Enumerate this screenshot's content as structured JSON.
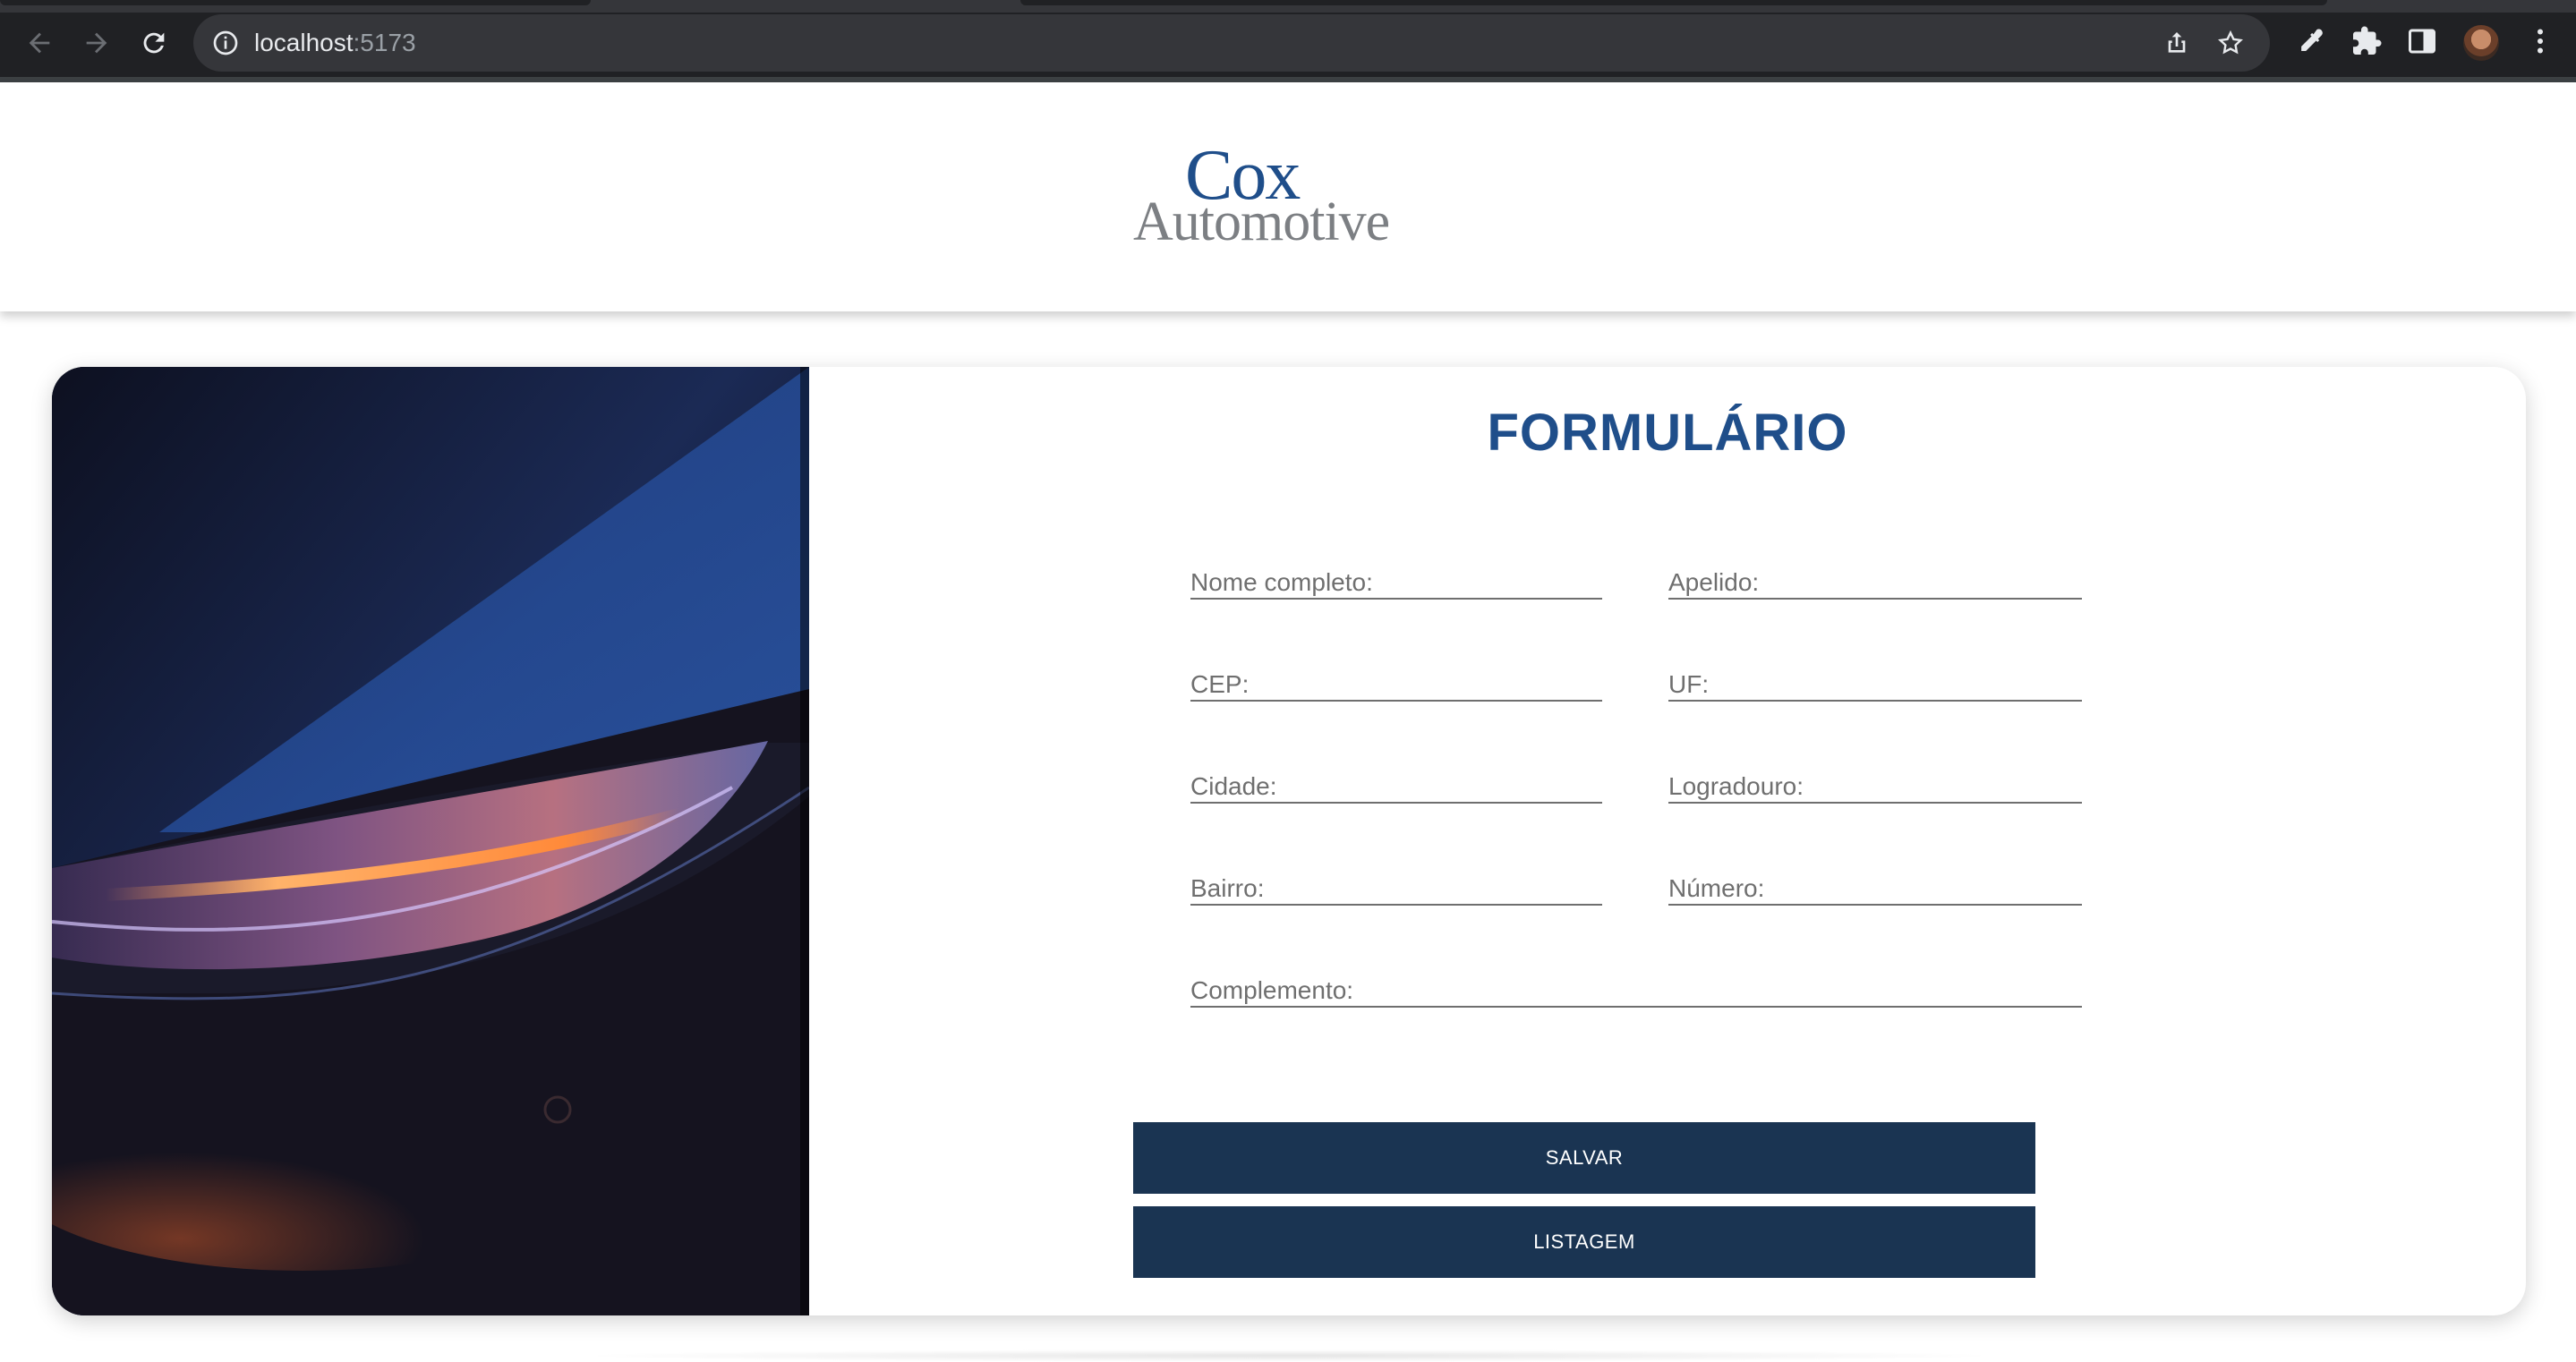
{
  "browser": {
    "url_host": "localhost",
    "url_port": ":5173",
    "icons": [
      "back-icon",
      "forward-icon",
      "reload-icon",
      "info-icon",
      "share-icon",
      "star-icon",
      "eyedropper-icon",
      "extensions-icon",
      "sidepanel-icon",
      "avatar",
      "menu-icon"
    ]
  },
  "header": {
    "logo_line1": "Cox",
    "logo_line2": "Automotive"
  },
  "form": {
    "title": "FORMULÁRIO",
    "fields": {
      "nome": "Nome completo:",
      "apelido": "Apelido:",
      "cep": "CEP:",
      "uf": "UF:",
      "cidade": "Cidade:",
      "logradouro": "Logradouro:",
      "bairro": "Bairro:",
      "numero": "Número:",
      "complemento": "Complemento:"
    },
    "buttons": {
      "save": "SALVAR",
      "list": "LISTAGEM"
    }
  },
  "colors": {
    "brand_blue": "#1f4e8a",
    "button_navy": "#1a3452",
    "chrome_dark": "#202124"
  }
}
